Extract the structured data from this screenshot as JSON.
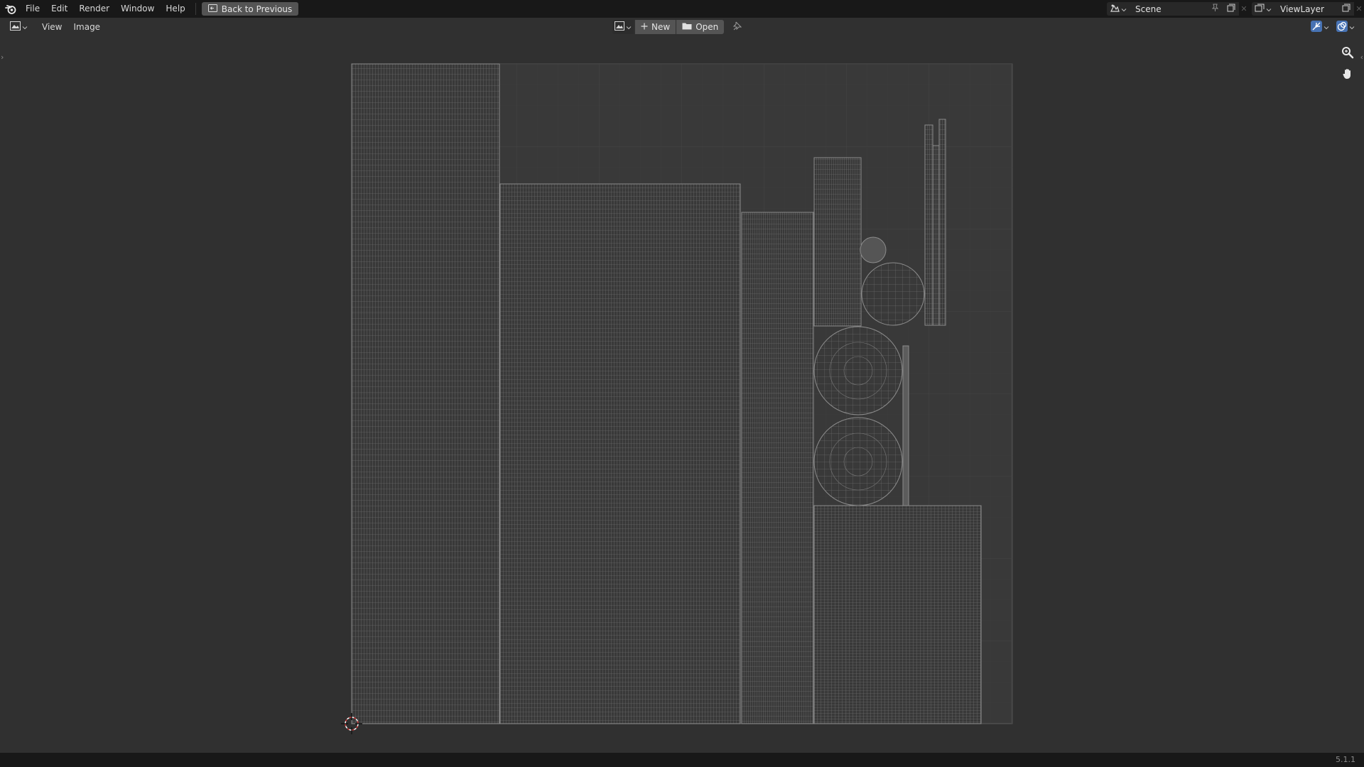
{
  "topbar": {
    "menus": [
      "File",
      "Edit",
      "Render",
      "Window",
      "Help"
    ],
    "back_button": "Back to Previous",
    "scene": "Scene",
    "view_layer": "ViewLayer"
  },
  "header": {
    "menus": [
      "View",
      "Image"
    ],
    "new_label": "New",
    "open_label": "Open"
  },
  "status": {
    "version": "5.1.1"
  },
  "icons": {
    "logo": "blender-logo-icon",
    "back": "back-to-previous-icon",
    "editor_type": "image-editor-icon",
    "new": "plus-icon",
    "open": "folder-icon",
    "pin": "pin-icon",
    "zoom": "zoom-icon",
    "pan": "hand-icon",
    "cursor": "2d-cursor-icon"
  },
  "colors": {
    "topbar_bg": "#181818",
    "area_bg": "#303030",
    "canvas_bg": "#3a3a3a",
    "button_bg": "#545454",
    "uv_wire": "#8a8a8a",
    "accent_blue": "#4772b3"
  }
}
